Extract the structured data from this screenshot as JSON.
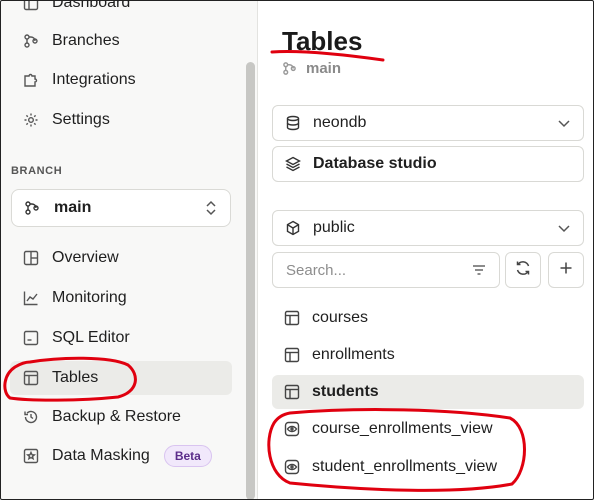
{
  "sidebar": {
    "top_items": [
      {
        "label": "Dashboard",
        "icon": "dashboard-icon"
      },
      {
        "label": "Branches",
        "icon": "branch-icon"
      },
      {
        "label": "Integrations",
        "icon": "puzzle-icon"
      },
      {
        "label": "Settings",
        "icon": "gear-icon"
      }
    ],
    "section_label": "BRANCH",
    "branch_select": {
      "value": "main"
    },
    "branch_items": [
      {
        "label": "Overview",
        "icon": "grid-icon"
      },
      {
        "label": "Monitoring",
        "icon": "chart-icon"
      },
      {
        "label": "SQL Editor",
        "icon": "sql-icon"
      },
      {
        "label": "Tables",
        "icon": "table-icon",
        "active": true
      },
      {
        "label": "Backup & Restore",
        "icon": "history-icon"
      },
      {
        "label": "Data Masking",
        "icon": "mask-icon",
        "badge": "Beta"
      }
    ]
  },
  "panel": {
    "title": "Tables",
    "branch": "main",
    "database_select": {
      "value": "neondb"
    },
    "studio_button": "Database studio",
    "schema_select": {
      "value": "public"
    },
    "search": {
      "placeholder": "Search..."
    },
    "tables": [
      {
        "label": "courses",
        "icon": "table-icon"
      },
      {
        "label": "enrollments",
        "icon": "table-icon"
      },
      {
        "label": "students",
        "icon": "table-icon",
        "active": true
      },
      {
        "label": "course_enrollments_view",
        "icon": "view-icon"
      },
      {
        "label": "student_enrollments_view",
        "icon": "view-icon"
      }
    ]
  },
  "colors": {
    "annotation": "#e0000f",
    "active_bg": "#ebebe8",
    "badge_bg": "#f1e8fb"
  }
}
